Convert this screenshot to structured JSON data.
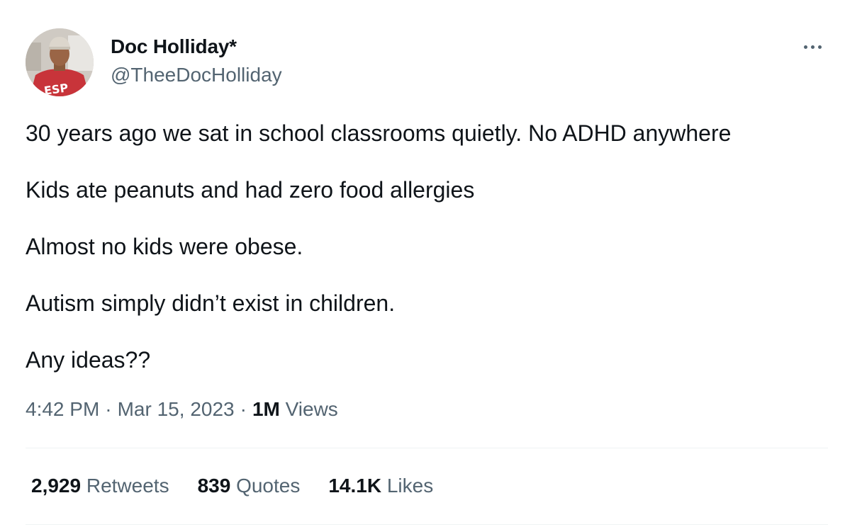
{
  "author": {
    "name": "Doc Holliday*",
    "handle": "@TheeDocHolliday",
    "avatar_icon": "user-avatar-photo"
  },
  "more_icon": "more-options-icon",
  "tweet": {
    "lines": [
      "30 years ago we sat in school classrooms quietly. No ADHD anywhere",
      "Kids ate peanuts and had zero food allergies",
      "Almost no kids were obese.",
      "Autism simply didn’t exist in children.",
      "Any ideas??"
    ]
  },
  "meta": {
    "time": "4:42 PM",
    "separator": "·",
    "date": "Mar 15, 2023",
    "views_count": "1M",
    "views_label": "Views"
  },
  "stats": {
    "retweets_count": "2,929",
    "retweets_label": "Retweets",
    "quotes_count": "839",
    "quotes_label": "Quotes",
    "likes_count": "14.1K",
    "likes_label": "Likes"
  },
  "colors": {
    "primary_text": "#0f1419",
    "secondary_text": "#536471",
    "divider": "#eff3f4"
  }
}
